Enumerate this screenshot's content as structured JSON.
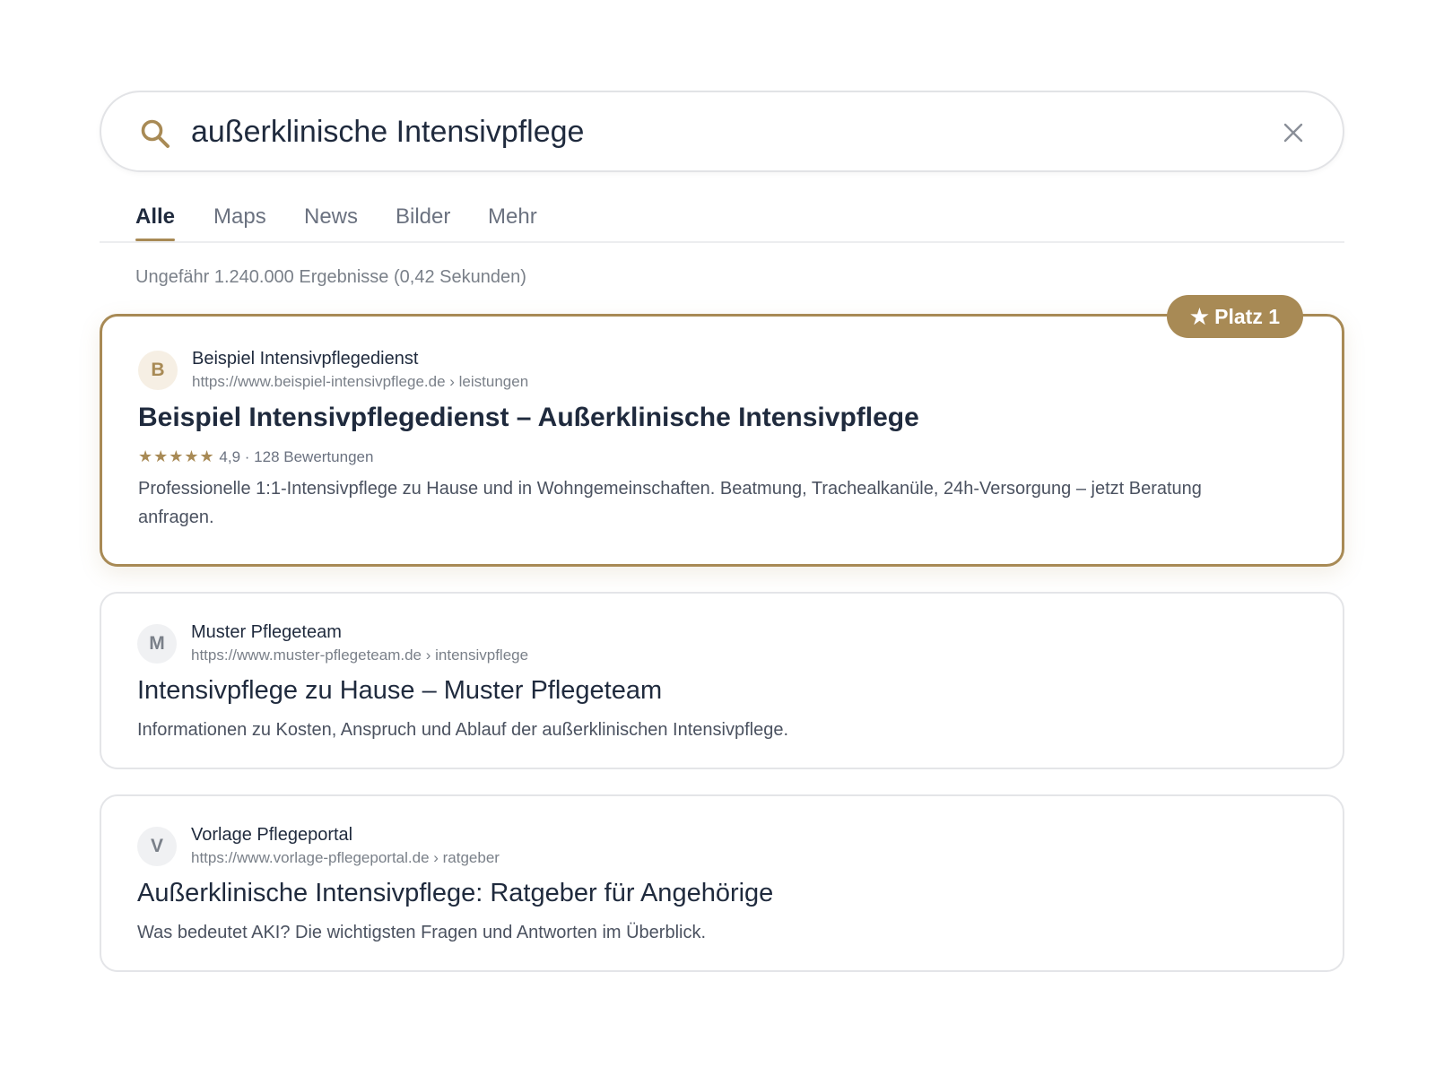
{
  "search": {
    "query": "außerklinische Intensivpflege"
  },
  "tabs": [
    {
      "label": "Alle",
      "active": true
    },
    {
      "label": "Maps",
      "active": false
    },
    {
      "label": "News",
      "active": false
    },
    {
      "label": "Bilder",
      "active": false
    },
    {
      "label": "Mehr",
      "active": false
    }
  ],
  "result_stats": "Ungefähr 1.240.000 Ergebnisse (0,42 Sekunden)",
  "results": [
    {
      "favicon_letter": "B",
      "site_name": "Beispiel Intensivpflegedienst",
      "url": "https://www.beispiel-intensivpflege.de › leistungen",
      "title": "Beispiel Intensivpflegedienst – Außerklinische Intensivpflege",
      "rating_stars": "★★★★★",
      "rating_text": "4,9 · 128 Bewertungen",
      "snippet": "Professionelle 1:1-Intensivpflege zu Hause und in Wohngemeinschaften. Beatmung, Trachealkanüle, 24h-Versorgung – jetzt Beratung anfragen.",
      "badge": "★ Platz 1"
    },
    {
      "favicon_letter": "M",
      "site_name": "Muster Pflegeteam",
      "url": "https://www.muster-pflegeteam.de › intensivpflege",
      "title": "Intensivpflege zu Hause – Muster Pflegeteam",
      "snippet": "Informationen zu Kosten, Anspruch und Ablauf der außerklinischen Intensivpflege."
    },
    {
      "favicon_letter": "V",
      "site_name": "Vorlage Pflegeportal",
      "url": "https://www.vorlage-pflegeportal.de › ratgeber",
      "title": "Außerklinische Intensivpflege: Ratgeber für Angehörige",
      "snippet": "Was bedeutet AKI? Die wichtigsten Fragen und Antworten im Überblick."
    }
  ],
  "colors": {
    "accent": "#a88a55",
    "text": "#1f2a3d",
    "muted": "#7a8089"
  },
  "icons": {
    "search": "search-icon",
    "clear": "close-icon"
  }
}
